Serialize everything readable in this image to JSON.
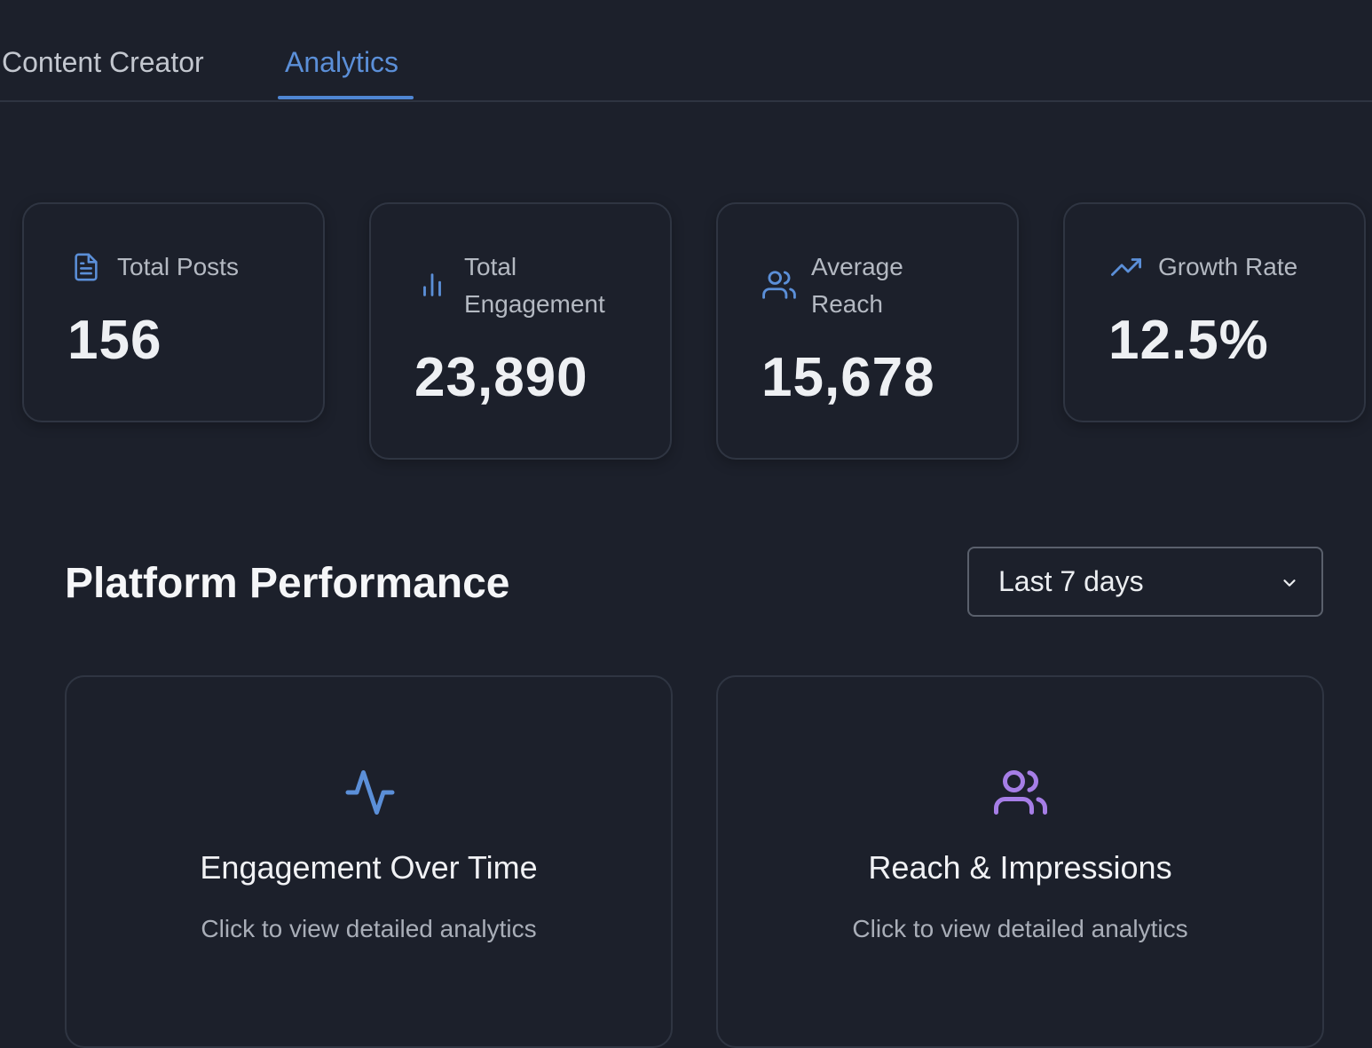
{
  "tabs": [
    {
      "label": "Content Creator",
      "active": false
    },
    {
      "label": "Analytics",
      "active": true
    }
  ],
  "stats": [
    {
      "icon": "document-icon",
      "label": "Total Posts",
      "value": "156"
    },
    {
      "icon": "bar-chart-icon",
      "label": "Total Engagement",
      "value": "23,890"
    },
    {
      "icon": "users-icon",
      "label": "Average Reach",
      "value": "15,678"
    },
    {
      "icon": "trending-up-icon",
      "label": "Growth Rate",
      "value": "12.5%"
    }
  ],
  "section": {
    "title": "Platform Performance",
    "period_select": {
      "value": "Last 7 days"
    }
  },
  "panels": [
    {
      "icon": "activity-icon",
      "title": "Engagement Over Time",
      "subtitle": "Click to view detailed analytics"
    },
    {
      "icon": "users-icon",
      "title": "Reach & Impressions",
      "subtitle": "Click to view detailed analytics"
    }
  ],
  "colors": {
    "background": "#1c202b",
    "accent_blue": "#5b8fd8",
    "accent_purple": "#a67ee6",
    "card_border": "#2f3542"
  }
}
